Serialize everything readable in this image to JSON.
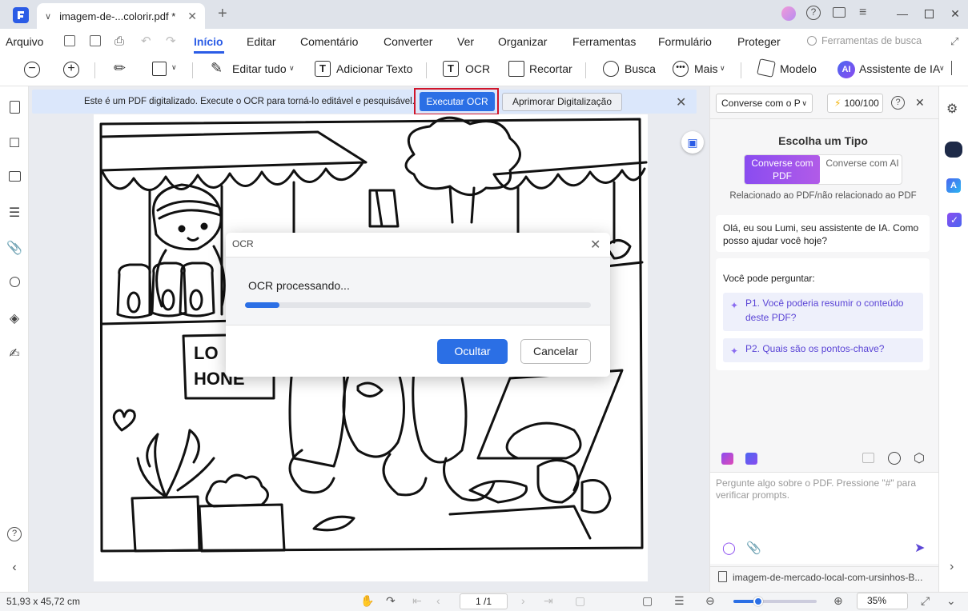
{
  "window": {
    "tab_title": "imagem-de-...colorir.pdf *",
    "new_tab": "+",
    "controls": [
      "minimize",
      "maximize",
      "close"
    ]
  },
  "menu": {
    "file": "Arquivo",
    "items": [
      "Início",
      "Editar",
      "Comentário",
      "Converter",
      "Ver",
      "Organizar",
      "Ferramentas",
      "Formulário",
      "Proteger"
    ],
    "search_placeholder": "Ferramentas de busca"
  },
  "toolbar": {
    "edit_all": "Editar tudo",
    "add_text": "Adicionar Texto",
    "ocr": "OCR",
    "crop": "Recortar",
    "search": "Busca",
    "more": "Mais",
    "template": "Modelo",
    "ai_badge": "AI",
    "ai_assistant": "Assistente de IA"
  },
  "banner": {
    "message": "Este é um PDF digitalizado. Execute o OCR para torná-lo editável e pesquisável.",
    "run_ocr": "Executar OCR",
    "enhance": "Aprimorar Digitalização"
  },
  "drawing": {
    "sign_text_1": "LO",
    "sign_text_2": "HONE"
  },
  "dialog": {
    "title": "OCR",
    "message": "OCR processando...",
    "progress_fraction": 0.1,
    "hide": "Ocultar",
    "cancel": "Cancelar"
  },
  "ai_panel": {
    "mode_select": "Converse com o P",
    "credits": "100/100",
    "choose_type": "Escolha um Tipo",
    "tab_pdf": "Converse com PDF",
    "tab_ai": "Converse com AI",
    "relation_text": "Relacionado ao PDF/não relacionado ao PDF",
    "greeting": "Olá, eu sou Lumi, seu assistente de IA. Como posso ajudar você hoje?",
    "can_ask": "Você pode perguntar:",
    "q1": "P1. Você poderia resumir o conteúdo deste PDF?",
    "q2": "P2. Quais são os pontos-chave?",
    "input_placeholder": "Pergunte algo sobre o PDF. Pressione \"#\" para verificar prompts.",
    "file_name": "imagem-de-mercado-local-com-ursinhos-B..."
  },
  "status": {
    "dimensions": "51,93 x 45,72 cm",
    "page": "1 /1",
    "zoom": "35%",
    "zoom_fraction": 0.3
  }
}
